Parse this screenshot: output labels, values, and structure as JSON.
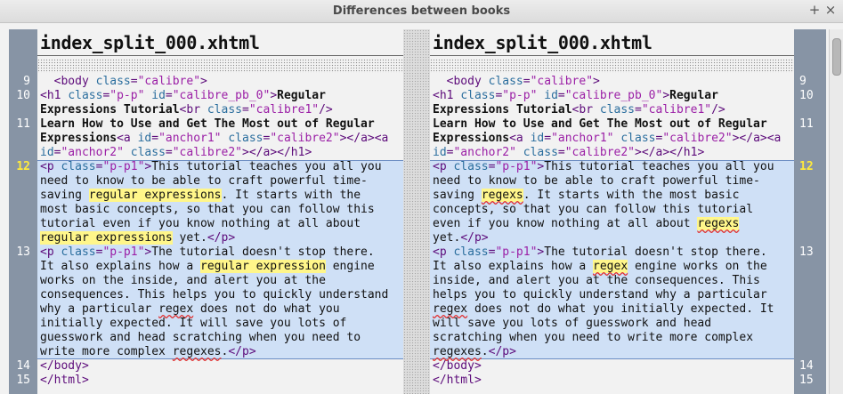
{
  "window": {
    "title": "Differences between books",
    "plus_label": "+",
    "close_label": "×"
  },
  "left": {
    "filename": "index_split_000.xhtml"
  },
  "right": {
    "filename": "index_split_000.xhtml"
  },
  "line_numbers": [
    "9",
    "10",
    "11",
    "12",
    "13",
    "14",
    "15"
  ],
  "active_line": "12"
}
